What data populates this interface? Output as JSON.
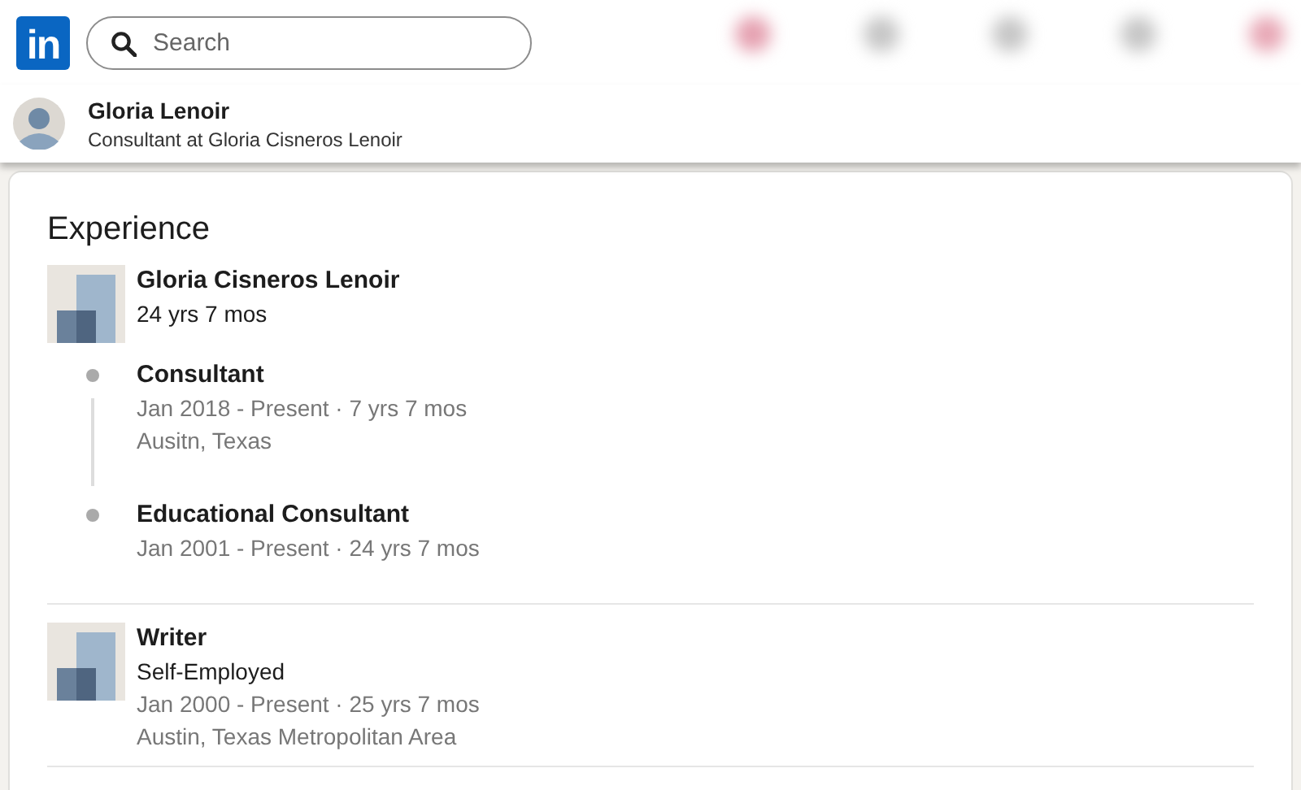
{
  "header": {
    "logo": "in",
    "search": {
      "placeholder": "Search"
    }
  },
  "profile": {
    "name": "Gloria Lenoir",
    "headline": "Consultant at Gloria Cisneros Lenoir"
  },
  "experience": {
    "title": "Experience",
    "entries": [
      {
        "kind": "group",
        "company": "Gloria Cisneros Lenoir",
        "duration": "24 yrs 7 mos",
        "roles": [
          {
            "title": "Consultant",
            "dates": "Jan 2018 - Present · 7 yrs 7 mos",
            "location": "Ausitn, Texas"
          },
          {
            "title": "Educational Consultant",
            "dates": "Jan 2001 - Present · 24 yrs 7 mos"
          }
        ]
      },
      {
        "kind": "single",
        "title": "Writer",
        "company": "Self-Employed",
        "dates": "Jan 2000 - Present · 25 yrs 7 mos",
        "location": "Austin, Texas Metropolitan Area"
      }
    ]
  }
}
